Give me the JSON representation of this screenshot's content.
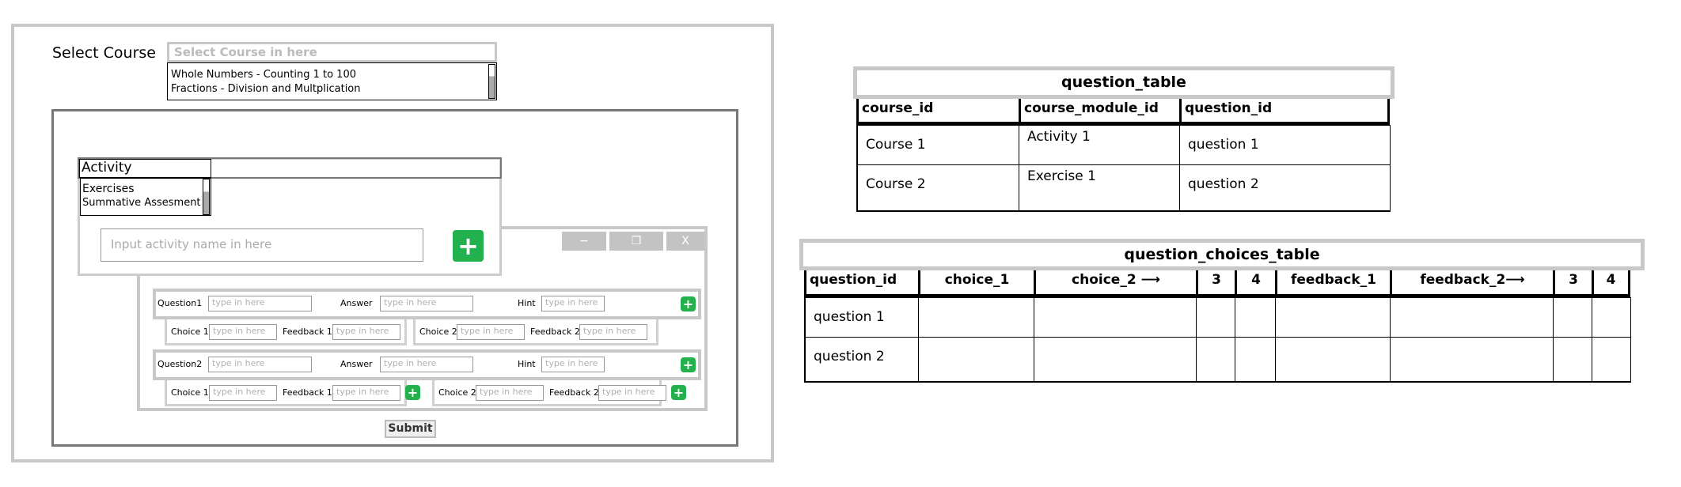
{
  "form": {
    "select_course_label": "Select Course",
    "select_course_placeholder": "Select Course in here",
    "course_options": [
      "Whole Numbers - Counting 1 to 100",
      "Fractions - Division and Multplication"
    ],
    "activity_label": "Activity",
    "activity_options": [
      "Exercises",
      "Summative Assesment"
    ],
    "activity_name_placeholder": "Input activity name in here",
    "window_buttons": {
      "minimize": "−",
      "restore": "❐",
      "close": "X"
    },
    "questions": [
      {
        "label": "Question1",
        "answer_label": "Answer",
        "hint_label": "Hint",
        "choice1_label": "Choice 1",
        "feedback1_label": "Feedback 1",
        "choice2_label": "Choice 2",
        "feedback2_label": "Feedback 2"
      },
      {
        "label": "Question2",
        "answer_label": "Answer",
        "hint_label": "Hint",
        "choice1_label": "Choice 1",
        "feedback1_label": "Feedback 1",
        "choice2_label": "Choice 2",
        "feedback2_label": "Feedback 2"
      }
    ],
    "field_placeholder": "type in here",
    "submit_label": "Submit"
  },
  "question_table": {
    "title": "question_table",
    "headers": [
      "course_id",
      "course_module_id",
      "question_id"
    ],
    "rows": [
      [
        "Course 1",
        "Activity 1",
        "question 1"
      ],
      [
        "Course 2",
        "Exercise 1",
        "question 2"
      ]
    ]
  },
  "question_choices_table": {
    "title": "question_choices_table",
    "headers": [
      "question_id",
      "choice_1",
      "choice_2 ⟶",
      "3",
      "4",
      "feedback_1",
      "feedback_2⟶",
      "3",
      "4"
    ],
    "rows": [
      [
        "question 1",
        "",
        "",
        "",
        "",
        "",
        "",
        "",
        ""
      ],
      [
        "question 2",
        "",
        "",
        "",
        "",
        "",
        "",
        "",
        ""
      ]
    ]
  },
  "colors": {
    "green": "#22b14c",
    "gray_border": "#c8c8c8"
  }
}
